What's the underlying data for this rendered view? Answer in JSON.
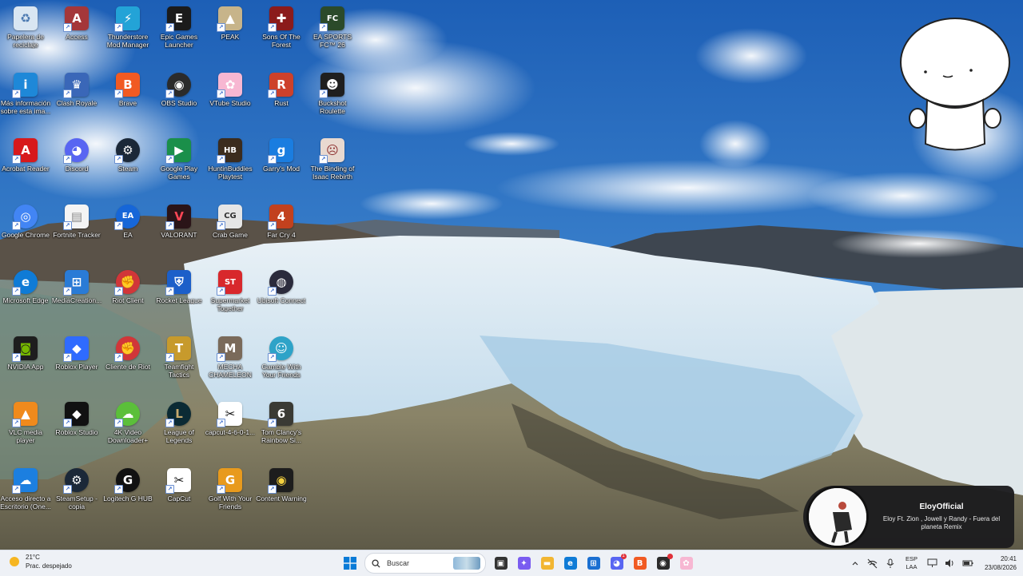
{
  "desktop": {
    "icons": [
      {
        "label": "Papelera de reciclaje",
        "icon": "recycle-bin-icon",
        "color": "#d9e6f2",
        "glyph": "♻",
        "fg": "#4a78b0"
      },
      {
        "label": "Access",
        "icon": "access-icon",
        "color": "#a4373a",
        "glyph": "A"
      },
      {
        "label": "Thunderstore Mod Manager",
        "icon": "thunderstore-icon",
        "color": "#23a3d7",
        "glyph": "⚡"
      },
      {
        "label": "Epic Games Launcher",
        "icon": "epic-games-icon",
        "color": "#1b1b1b",
        "glyph": "E"
      },
      {
        "label": "PEAK",
        "icon": "peak-icon",
        "color": "#c7b48a",
        "glyph": "▲"
      },
      {
        "label": "Sons Of The Forest",
        "icon": "sons-of-the-forest-icon",
        "color": "#8b1b1b",
        "glyph": "✚"
      },
      {
        "label": "EA SPORTS FC™ 26",
        "icon": "ea-fc-icon",
        "color": "#2b4a2a",
        "glyph": "FC"
      },
      {
        "label": "Más información sobre esta ima...",
        "icon": "info-spotlight-icon",
        "color": "#1e88d8",
        "glyph": "i"
      },
      {
        "label": "Clash Royale",
        "icon": "clash-royale-icon",
        "color": "#3a67b8",
        "glyph": "♛"
      },
      {
        "label": "Brave",
        "icon": "brave-icon",
        "color": "#f15a22",
        "glyph": "B"
      },
      {
        "label": "OBS Studio",
        "icon": "obs-icon",
        "color": "#2b2b2b",
        "glyph": "◉",
        "round": true
      },
      {
        "label": "VTube Studio",
        "icon": "vtube-studio-icon",
        "color": "#f7b7d2",
        "glyph": "✿"
      },
      {
        "label": "Rust",
        "icon": "rust-icon",
        "color": "#cd412b",
        "glyph": "R"
      },
      {
        "label": "Buckshot Roulette",
        "icon": "buckshot-roulette-icon",
        "color": "#1f1f1f",
        "glyph": "☻"
      },
      {
        "label": "Acrobat Reader",
        "icon": "acrobat-icon",
        "color": "#d7191c",
        "glyph": "A"
      },
      {
        "label": "Discord",
        "icon": "discord-icon",
        "color": "#5865f2",
        "glyph": "◕",
        "round": true
      },
      {
        "label": "Steam",
        "icon": "steam-icon",
        "color": "#1b2838",
        "glyph": "⚙",
        "round": true
      },
      {
        "label": "Google Play Games",
        "icon": "google-play-games-icon",
        "color": "#1a8f4a",
        "glyph": "▶"
      },
      {
        "label": "HuntinBuddies Playtest",
        "icon": "huntinbuddies-icon",
        "color": "#3b2c1e",
        "glyph": "HB"
      },
      {
        "label": "Garry's Mod",
        "icon": "garrys-mod-icon",
        "color": "#1a7de0",
        "glyph": "g"
      },
      {
        "label": "The Binding of Isaac Rebirth",
        "icon": "binding-of-isaac-icon",
        "color": "#e8d9d0",
        "glyph": "☹",
        "fg": "#8a2a2a"
      },
      {
        "label": "Google Chrome",
        "icon": "chrome-icon",
        "color": "#4285f4",
        "glyph": "◎",
        "round": true
      },
      {
        "label": "Fortnite Tracker",
        "icon": "file-icon",
        "color": "#f4f4f4",
        "glyph": "▤",
        "fg": "#888"
      },
      {
        "label": "EA",
        "icon": "ea-icon",
        "color": "#1666d8",
        "glyph": "EA",
        "round": true
      },
      {
        "label": "VALORANT",
        "icon": "valorant-icon",
        "color": "#2a1418",
        "glyph": "V",
        "fg": "#ff4655"
      },
      {
        "label": "Crab Game",
        "icon": "crab-game-icon",
        "color": "#e6e6e6",
        "glyph": "CG",
        "fg": "#333"
      },
      {
        "label": "Far Cry 4",
        "icon": "far-cry-4-icon",
        "color": "#c2411e",
        "glyph": "4"
      },
      {
        "label": "",
        "icon": "",
        "color": "",
        "glyph": ""
      },
      {
        "label": "Microsoft Edge",
        "icon": "edge-icon",
        "color": "#0f7bd6",
        "glyph": "e",
        "round": true
      },
      {
        "label": "MediaCreation...",
        "icon": "media-creation-tool-icon",
        "color": "#2a7bd6",
        "glyph": "⊞"
      },
      {
        "label": "Riot Client",
        "icon": "riot-client-icon",
        "color": "#d13639",
        "glyph": "✊",
        "round": true
      },
      {
        "label": "Rocket League",
        "icon": "rocket-league-icon",
        "color": "#1c5fc9",
        "glyph": "⛨"
      },
      {
        "label": "Supermarket Together",
        "icon": "supermarket-together-icon",
        "color": "#d8282c",
        "glyph": "ST"
      },
      {
        "label": "Ubisoft Connect",
        "icon": "ubisoft-connect-icon",
        "color": "#2b2b3c",
        "glyph": "◍",
        "round": true
      },
      {
        "label": "",
        "icon": "",
        "color": "",
        "glyph": ""
      },
      {
        "label": "NVIDIA App",
        "icon": "nvidia-icon",
        "color": "#1e1e1e",
        "glyph": "◙",
        "fg": "#76b900"
      },
      {
        "label": "Roblox Player",
        "icon": "roblox-player-icon",
        "color": "#2f6bff",
        "glyph": "◆"
      },
      {
        "label": "Cliente de Riot",
        "icon": "riot-client-icon",
        "color": "#d13639",
        "glyph": "✊",
        "round": true
      },
      {
        "label": "Teamfight Tactics",
        "icon": "teamfight-tactics-icon",
        "color": "#c79a2c",
        "glyph": "T"
      },
      {
        "label": "MECHA CHAMELEON",
        "icon": "mecha-chameleon-icon",
        "color": "#7a6a5a",
        "glyph": "M"
      },
      {
        "label": "Gamble With Your Friends",
        "icon": "gamble-with-your-friends-icon",
        "color": "#2ea3c8",
        "glyph": "☺",
        "round": true
      },
      {
        "label": "",
        "icon": "",
        "color": "",
        "glyph": ""
      },
      {
        "label": "VLC media player",
        "icon": "vlc-icon",
        "color": "#f08a1c",
        "glyph": "▲"
      },
      {
        "label": "Roblox Studio",
        "icon": "roblox-studio-icon",
        "color": "#111111",
        "glyph": "◆"
      },
      {
        "label": "4K Video Downloader+",
        "icon": "4k-video-downloader-icon",
        "color": "#5bbf3a",
        "glyph": "☁",
        "round": true
      },
      {
        "label": "League of Legends",
        "icon": "league-of-legends-icon",
        "color": "#0b2a34",
        "glyph": "L",
        "fg": "#c8aa6e",
        "round": true
      },
      {
        "label": "capcut-4-6-0-1...",
        "icon": "capcut-installer-icon",
        "color": "#ffffff",
        "glyph": "✂",
        "fg": "#111"
      },
      {
        "label": "Tom Clancy's Rainbow Si...",
        "icon": "rainbow-six-icon",
        "color": "#3a3a34",
        "glyph": "6"
      },
      {
        "label": "",
        "icon": "",
        "color": "",
        "glyph": ""
      },
      {
        "label": "Acceso directo a Escritorio (One...",
        "icon": "onedrive-icon",
        "color": "#1c7fe0",
        "glyph": "☁"
      },
      {
        "label": "SteamSetup - copia",
        "icon": "steam-setup-icon",
        "color": "#1b2838",
        "glyph": "⚙",
        "round": true
      },
      {
        "label": "Logitech G HUB",
        "icon": "logitech-g-hub-icon",
        "color": "#111111",
        "glyph": "G",
        "round": true
      },
      {
        "label": "CapCut",
        "icon": "capcut-icon",
        "color": "#ffffff",
        "glyph": "✂",
        "fg": "#111"
      },
      {
        "label": "Golf With Your Friends",
        "icon": "golf-with-your-friends-icon",
        "color": "#e89a1d",
        "glyph": "G"
      },
      {
        "label": "Content Warning",
        "icon": "content-warning-icon",
        "color": "#1d1d1d",
        "glyph": "◉",
        "fg": "#f4d03f"
      },
      {
        "label": "",
        "icon": "",
        "color": "",
        "glyph": ""
      }
    ]
  },
  "media_popup": {
    "artist": "EloyOfficial",
    "song": "Eloy Ft. Zion , Jowell y Randy - Fuera del planeta Remix"
  },
  "taskbar": {
    "weather": {
      "temp": "21°C",
      "condition": "Prac. despejado"
    },
    "search_placeholder": "Buscar",
    "apps": [
      {
        "name": "task-view-button",
        "icon": "task-view-icon",
        "color": "#333",
        "glyph": "▣"
      },
      {
        "name": "widgets-button",
        "icon": "copilot-icon",
        "color": "#7a5cf0",
        "glyph": "✦"
      },
      {
        "name": "file-explorer-button",
        "icon": "folder-icon",
        "color": "#f2b632",
        "glyph": "▬"
      },
      {
        "name": "edge-taskbar-button",
        "icon": "edge-icon",
        "color": "#0f7bd6",
        "glyph": "e"
      },
      {
        "name": "store-button",
        "icon": "microsoft-store-icon",
        "color": "#1a6fd1",
        "glyph": "⊞"
      },
      {
        "name": "discord-taskbar-button",
        "icon": "discord-icon",
        "color": "#5865f2",
        "glyph": "◕",
        "badge": "1"
      },
      {
        "name": "brave-taskbar-button",
        "icon": "brave-icon",
        "color": "#f15a22",
        "glyph": "B"
      },
      {
        "name": "obs-taskbar-button",
        "icon": "obs-icon",
        "color": "#2b2b2b",
        "glyph": "◉",
        "badge": ""
      },
      {
        "name": "vtube-taskbar-button",
        "icon": "vtube-studio-icon",
        "color": "#f7b7d2",
        "glyph": "✿"
      }
    ],
    "language": {
      "line1": "ESP",
      "line2": "LAA"
    },
    "clock": {
      "time": "20:41",
      "date": "23/08/2026"
    }
  }
}
